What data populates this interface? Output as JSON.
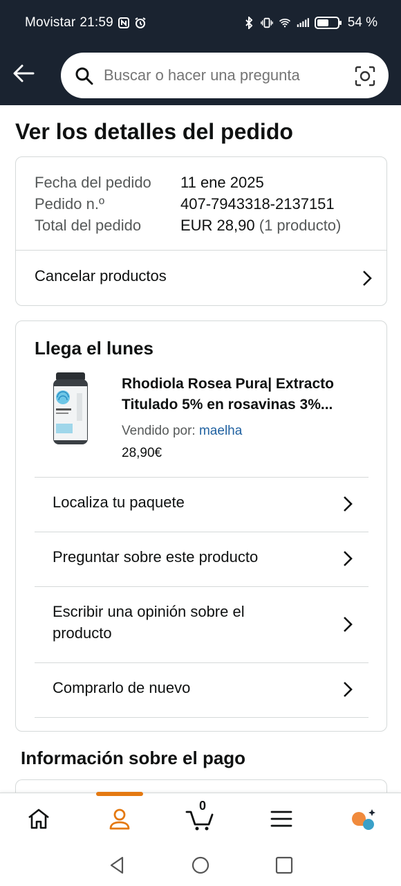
{
  "status_bar": {
    "carrier": "Movistar",
    "time": "21:59",
    "battery": "54 %"
  },
  "search": {
    "placeholder": "Buscar o hacer una pregunta"
  },
  "page": {
    "title": "Ver los detalles del pedido"
  },
  "order_summary": {
    "date_label": "Fecha del pedido",
    "date_value": "11 ene 2025",
    "number_label": "Pedido n.º",
    "number_value": "407-7943318-2137151",
    "total_label": "Total del pedido",
    "total_value": "EUR 28,90",
    "total_count": "(1 producto)",
    "cancel_label": "Cancelar productos"
  },
  "shipment": {
    "arrival": "Llega el lunes",
    "product_title": "Rhodiola Rosea Pura| Extracto Titulado 5% en rosavinas 3%...",
    "sold_by_label": "Vendido por:",
    "seller": "maelha",
    "price": "28,90€",
    "actions": [
      {
        "label": "Localiza tu paquete"
      },
      {
        "label": "Preguntar sobre este producto"
      },
      {
        "label": "Escribir una opinión sobre el producto"
      },
      {
        "label": "Comprarlo de nuevo"
      }
    ]
  },
  "payment": {
    "title": "Información sobre el pago"
  },
  "bottom_nav": {
    "cart_count": "0",
    "active": "account",
    "accent_color": "#e47911"
  },
  "colors": {
    "header_bg": "#1a2330",
    "link": "#2162a1",
    "border": "#d5d9d9"
  }
}
